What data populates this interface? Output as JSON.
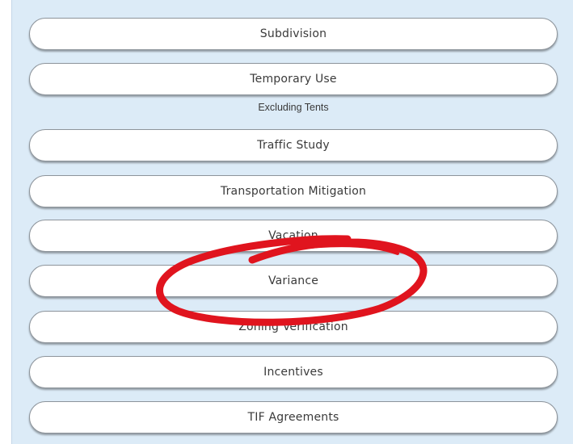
{
  "buttons": [
    {
      "label": "Subdivision"
    },
    {
      "label": "Temporary Use"
    },
    {
      "label": "Traffic Study"
    },
    {
      "label": "Transportation Mitigation"
    },
    {
      "label": "Vacation"
    },
    {
      "label": "Variance"
    },
    {
      "label": "Zoning Verification"
    },
    {
      "label": "Incentives"
    },
    {
      "label": "TIF Agreements"
    }
  ],
  "notes": {
    "temporary_use": "Excluding Tents"
  },
  "colors": {
    "panel_background": "#dcebf7",
    "button_background": "#ffffff",
    "annotation_red": "#e0141e"
  }
}
